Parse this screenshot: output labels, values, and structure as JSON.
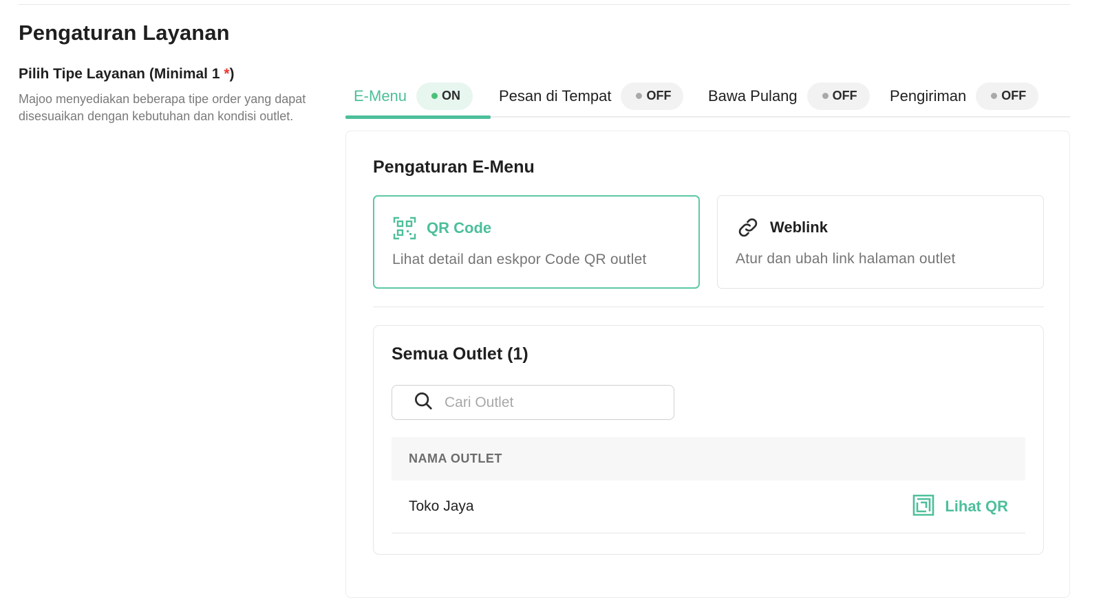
{
  "page": {
    "title": "Pengaturan Layanan"
  },
  "service_type": {
    "label": "Pilih Tipe Layanan (Minimal 1 ",
    "required_mark": "*",
    "label_end": ")",
    "description": "Majoo menyediakan beberapa tipe order yang dapat disesuaikan dengan kebutuhan dan kondisi outlet."
  },
  "tabs": [
    {
      "label": "E-Menu",
      "status": "ON",
      "active": true
    },
    {
      "label": "Pesan di Tempat",
      "status": "OFF",
      "active": false
    },
    {
      "label": "Bawa Pulang",
      "status": "OFF",
      "active": false
    },
    {
      "label": "Pengiriman",
      "status": "OFF",
      "active": false
    }
  ],
  "emenu": {
    "title": "Pengaturan E-Menu",
    "options": [
      {
        "title": "QR Code",
        "description": "Lihat detail dan eskpor Code QR outlet",
        "icon": "qr-code-icon",
        "selected": true
      },
      {
        "title": "Weblink",
        "description": "Atur dan ubah link halaman outlet",
        "icon": "link-icon",
        "selected": false
      }
    ]
  },
  "outlets": {
    "title": "Semua Outlet (1)",
    "search_placeholder": "Cari Outlet",
    "column_header": "NAMA OUTLET",
    "rows": [
      {
        "name": "Toko Jaya",
        "action": "Lihat QR"
      }
    ]
  },
  "colors": {
    "accent": "#4cbf9a",
    "on_dot": "#4cbf7a",
    "off_dot": "#a9a9a9",
    "required": "#e53935"
  }
}
